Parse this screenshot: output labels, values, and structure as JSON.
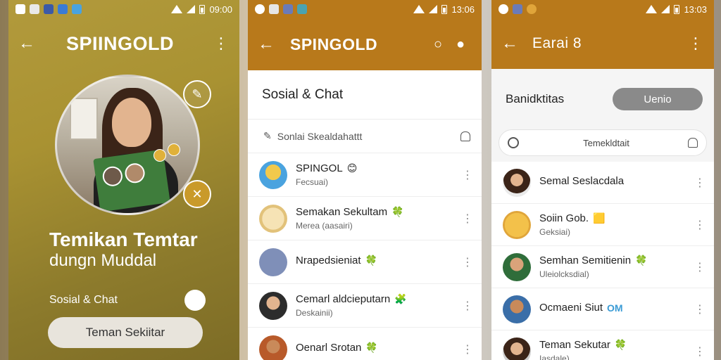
{
  "screen1": {
    "status_time": "09:00",
    "app_title": "SPIINGOLD",
    "headline1": "Temikan Temtar",
    "headline2": "dungn Muddal",
    "toggle_label": "Sosial & Chat",
    "toggle_on": true,
    "button_label": "Teman Sekiitar"
  },
  "screen2": {
    "status_time": "13:06",
    "app_title": "SPINGOLD",
    "section_title": "Sosial & Chat",
    "search_text": "Sonlai Skealdahattt",
    "items": [
      {
        "name": "SPINGOL",
        "sub": "Fecsuai)",
        "badge": "😊"
      },
      {
        "name": "Semakan Sekultam",
        "sub": "Merea (aasairi)",
        "badge": "🍀"
      },
      {
        "name": "Nrapedsieniat",
        "sub": "",
        "badge": "🍀"
      },
      {
        "name": "Cemarl aldcieputarn",
        "sub": "Deskainii)",
        "badge": "🧩"
      },
      {
        "name": "Oenarl Srotan",
        "sub": "",
        "badge": "🍀"
      }
    ]
  },
  "screen3": {
    "status_time": "13:03",
    "app_title": "Earai 8",
    "row_label": "Banidktitas",
    "row_button": "Uenio",
    "search_text": "Temekldtait",
    "items": [
      {
        "name": "Semal Seslacdala",
        "sub": "",
        "badge": ""
      },
      {
        "name": "Soiin Gob.",
        "sub": "Geksiai)",
        "badge": "🟨"
      },
      {
        "name": "Semhan Semitienin",
        "sub": "Uleiolcksdial)",
        "badge": "🍀"
      },
      {
        "name": "Ocmaeni Siut",
        "sub": "",
        "badge": "OM"
      },
      {
        "name": "Teman Sekutar",
        "sub": "Iasdale)",
        "badge": "🍀"
      }
    ]
  },
  "colors": {
    "brand": "#b8791b",
    "hero_gold": "#a99232"
  }
}
